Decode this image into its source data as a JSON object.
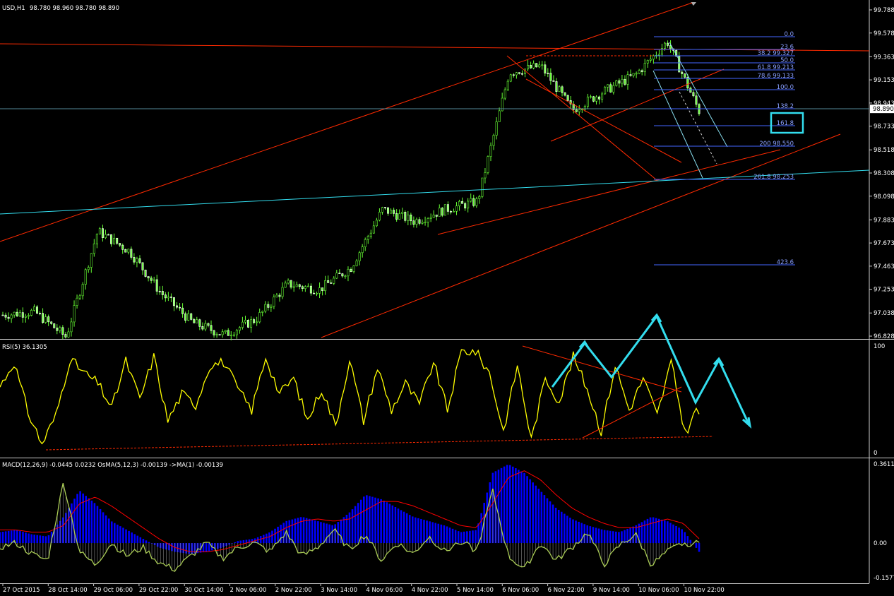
{
  "price_header": {
    "symbol": "USD,H1",
    "ohlc": "98.780 98.960 98.780 98.890"
  },
  "rsi_header": "RSI(5) 36.1305",
  "macd_header": "MACD(12,26,9) -0.0445 0.0232  OsMA(5,12,3) -0.00139  ->MA(1) -0.00139",
  "colors": {
    "bull": "#66ff33",
    "bear": "#ffffff",
    "trend": "#ff2a00",
    "cyan": "#33ddee",
    "fib": "#4466ff",
    "rsi": "#ffff00",
    "hist": "#0000ff",
    "signal": "#ff0000",
    "osma": "#aacc55"
  },
  "chart_data": [
    {
      "type": "candlestick",
      "title": "USD,H1",
      "ylim": [
        96.76,
        99.85
      ],
      "y_ticks": [
        "99.788",
        "99.578",
        "99.363",
        "99.153",
        "98.943",
        "98.733",
        "98.518",
        "98.308",
        "98.098",
        "97.883",
        "97.673",
        "97.463",
        "97.253",
        "97.038",
        "96.828"
      ],
      "current_price": "98.890",
      "waypoints": [
        {
          "time": "27 Oct 2015",
          "price": 97.02
        },
        {
          "time": "28 Oct 02:00",
          "price": 97.05
        },
        {
          "time": "28 Oct 12:00",
          "price": 96.82
        },
        {
          "time": "28 Oct 14:00",
          "price": 97.78
        },
        {
          "time": "29 Oct 06:00",
          "price": 97.6
        },
        {
          "time": "29 Oct 22:00",
          "price": 97.22
        },
        {
          "time": "30 Oct 14:00",
          "price": 96.95
        },
        {
          "time": "2 Nov 06:00",
          "price": 96.84
        },
        {
          "time": "2 Nov 22:00",
          "price": 96.98
        },
        {
          "time": "3 Nov 10:00",
          "price": 97.3
        },
        {
          "time": "3 Nov 14:00",
          "price": 97.25
        },
        {
          "time": "4 Nov 06:00",
          "price": 97.45
        },
        {
          "time": "4 Nov 10:00",
          "price": 97.98
        },
        {
          "time": "4 Nov 22:00",
          "price": 97.87
        },
        {
          "time": "5 Nov 14:00",
          "price": 97.98
        },
        {
          "time": "6 Nov 06:00",
          "price": 98.05
        },
        {
          "time": "6 Nov 10:00",
          "price": 99.22
        },
        {
          "time": "6 Nov 22:00",
          "price": 99.28
        },
        {
          "time": "9 Nov 06:00",
          "price": 98.88
        },
        {
          "time": "9 Nov 14:00",
          "price": 99.05
        },
        {
          "time": "10 Nov 06:00",
          "price": 99.2
        },
        {
          "time": "10 Nov 10:00",
          "price": 99.5
        },
        {
          "time": "10 Nov 22:00",
          "price": 98.87
        }
      ],
      "fibonacci_labels": [
        "0.0",
        "23.6",
        "38.2 99.327",
        "50.0",
        "61.8 99.213",
        "78.6 99.133",
        "100.0",
        "138.2",
        "161.8",
        "200 98.550",
        "261.8 98.253",
        "423.6"
      ]
    },
    {
      "type": "line",
      "title": "RSI(5) 36.1305",
      "ylim": [
        0,
        100
      ],
      "y_ticks": [
        "100",
        "0"
      ],
      "series": [
        {
          "name": "RSI(5)",
          "values": [
            62,
            85,
            38,
            8,
            35,
            88,
            75,
            65,
            42,
            86,
            50,
            90,
            30,
            55,
            45,
            82,
            85,
            60,
            40,
            90,
            55,
            70,
            30,
            60,
            25,
            88,
            30,
            80,
            40,
            65,
            45,
            85,
            40,
            95,
            95,
            75,
            20,
            82,
            12,
            70,
            48,
            90,
            60,
            20,
            82,
            40,
            70,
            35,
            85,
            18,
            45
          ]
        }
      ],
      "last_value": 36.13
    },
    {
      "type": "bar",
      "title": "MACD(12,26,9)",
      "ylim": [
        -0.1577,
        0.3611
      ],
      "y_ticks": [
        "0.3611",
        "0.00",
        "-0.1577"
      ],
      "series": [
        {
          "name": "MACD(12,26,9)",
          "values": [
            0.05,
            0.06,
            0.04,
            0.03,
            0.12,
            0.24,
            0.18,
            0.1,
            0.06,
            0.02,
            -0.02,
            -0.04,
            -0.05,
            -0.04,
            -0.02,
            0.01,
            0.02,
            0.05,
            0.1,
            0.12,
            0.1,
            0.08,
            0.14,
            0.22,
            0.2,
            0.16,
            0.12,
            0.1,
            0.08,
            0.05,
            0.06,
            0.32,
            0.36,
            0.32,
            0.24,
            0.16,
            0.11,
            0.08,
            0.06,
            0.05,
            0.08,
            0.12,
            0.1,
            0.06,
            -0.04
          ]
        },
        {
          "name": "Signal",
          "values": [
            0.06,
            0.06,
            0.05,
            0.05,
            0.08,
            0.18,
            0.21,
            0.17,
            0.12,
            0.07,
            0.02,
            -0.02,
            -0.04,
            -0.04,
            -0.03,
            -0.01,
            0.01,
            0.03,
            0.07,
            0.1,
            0.11,
            0.1,
            0.11,
            0.15,
            0.19,
            0.19,
            0.17,
            0.14,
            0.11,
            0.08,
            0.07,
            0.18,
            0.3,
            0.33,
            0.29,
            0.22,
            0.16,
            0.12,
            0.09,
            0.07,
            0.07,
            0.09,
            0.11,
            0.09,
            0.02
          ]
        },
        {
          "name": "OsMA(5,12,3)",
          "values": [
            -0.02,
            0.0,
            -0.05,
            -0.08,
            0.28,
            -0.04,
            -0.1,
            0.0,
            -0.06,
            -0.02,
            -0.09,
            -0.12,
            -0.06,
            0.0,
            -0.07,
            -0.02,
            0.0,
            -0.04,
            0.05,
            -0.06,
            -0.02,
            0.06,
            -0.03,
            0.04,
            -0.08,
            0.0,
            -0.05,
            0.03,
            -0.04,
            0.01,
            -0.04,
            0.24,
            -0.06,
            -0.12,
            0.0,
            -0.08,
            -0.02,
            0.05,
            -0.1,
            -0.01,
            0.04,
            -0.1,
            -0.04,
            0.0,
            -0.00139
          ]
        }
      ]
    }
  ],
  "x_ticks": [
    "27 Oct 2015",
    "28 Oct 14:00",
    "29 Oct 06:00",
    "29 Oct 22:00",
    "30 Oct 14:00",
    "2 Nov 06:00",
    "2 Nov 22:00",
    "3 Nov 14:00",
    "4 Nov 06:00",
    "4 Nov 22:00",
    "5 Nov 14:00",
    "6 Nov 06:00",
    "6 Nov 22:00",
    "9 Nov 14:00",
    "10 Nov 06:00",
    "10 Nov 22:00"
  ]
}
